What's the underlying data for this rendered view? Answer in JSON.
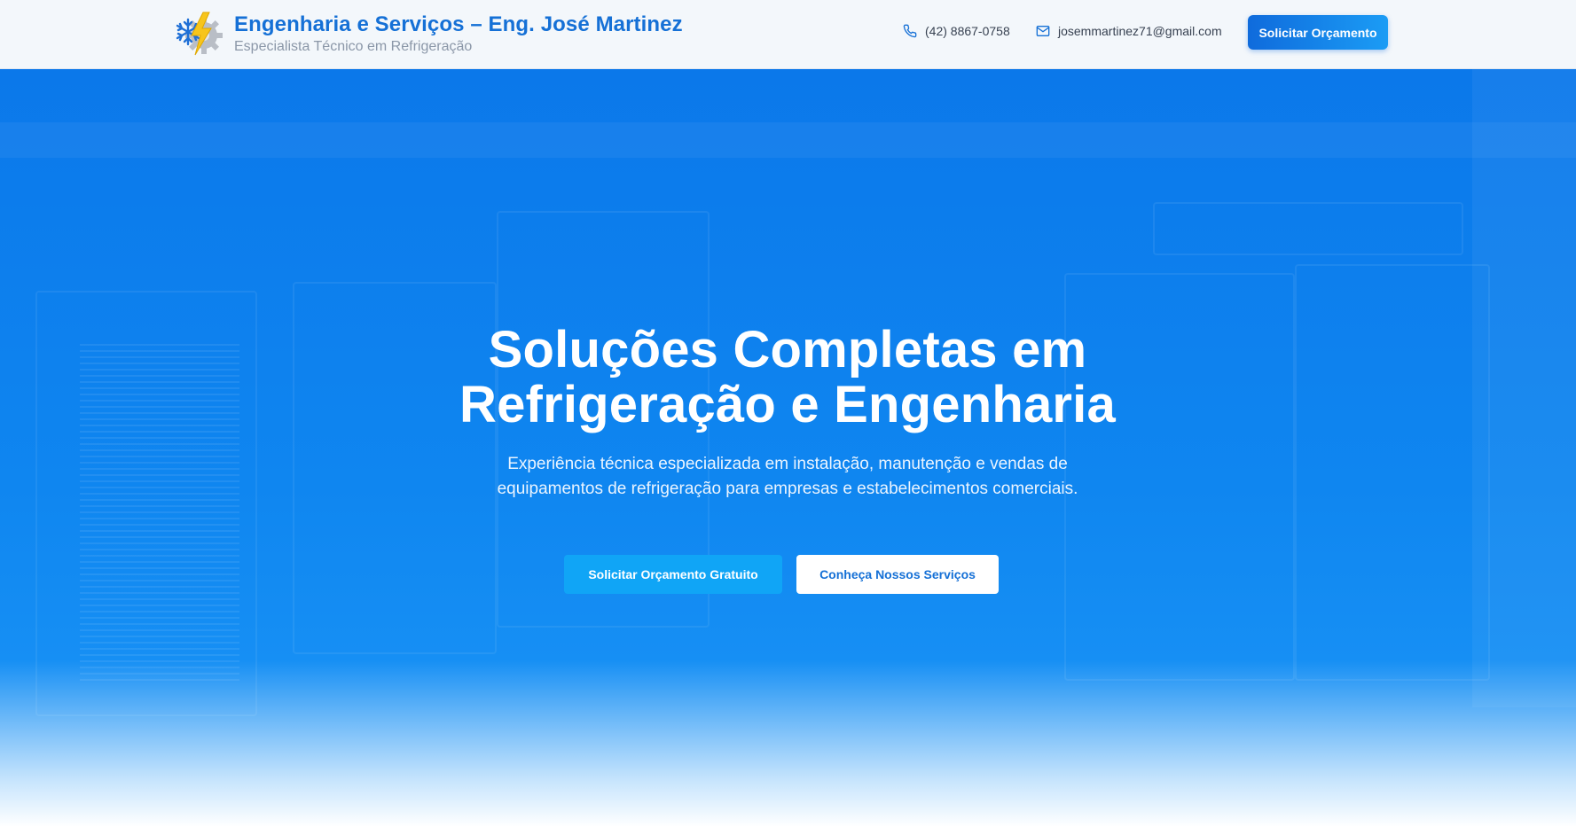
{
  "header": {
    "title": "Engenharia e Serviços – Eng. José Martinez",
    "subtitle": "Especialista Técnico em Refrigeração",
    "phone": "(42) 8867-0758",
    "email": "josemmartinez71@gmail.com",
    "cta_label": "Solicitar Orçamento",
    "icons": {
      "logo": "snowflake-gear-bolt-logo",
      "phone": "phone-icon",
      "email": "mail-icon"
    }
  },
  "hero": {
    "title": "Soluções Completas em Refrigeração e Engenharia",
    "description": "Experiência técnica especializada em instalação, manutenção e vendas de equipamentos de refrigeração para empresas e estabelecimentos comerciais.",
    "primary_button": "Solicitar Orçamento Gratuito",
    "secondary_button": "Conheça Nossos Serviços"
  },
  "colors": {
    "brand": "#1570d6",
    "hero_blue": "#0b78ea",
    "primary_button": "#10a5f6",
    "header_bg": "#f3f7fb"
  }
}
